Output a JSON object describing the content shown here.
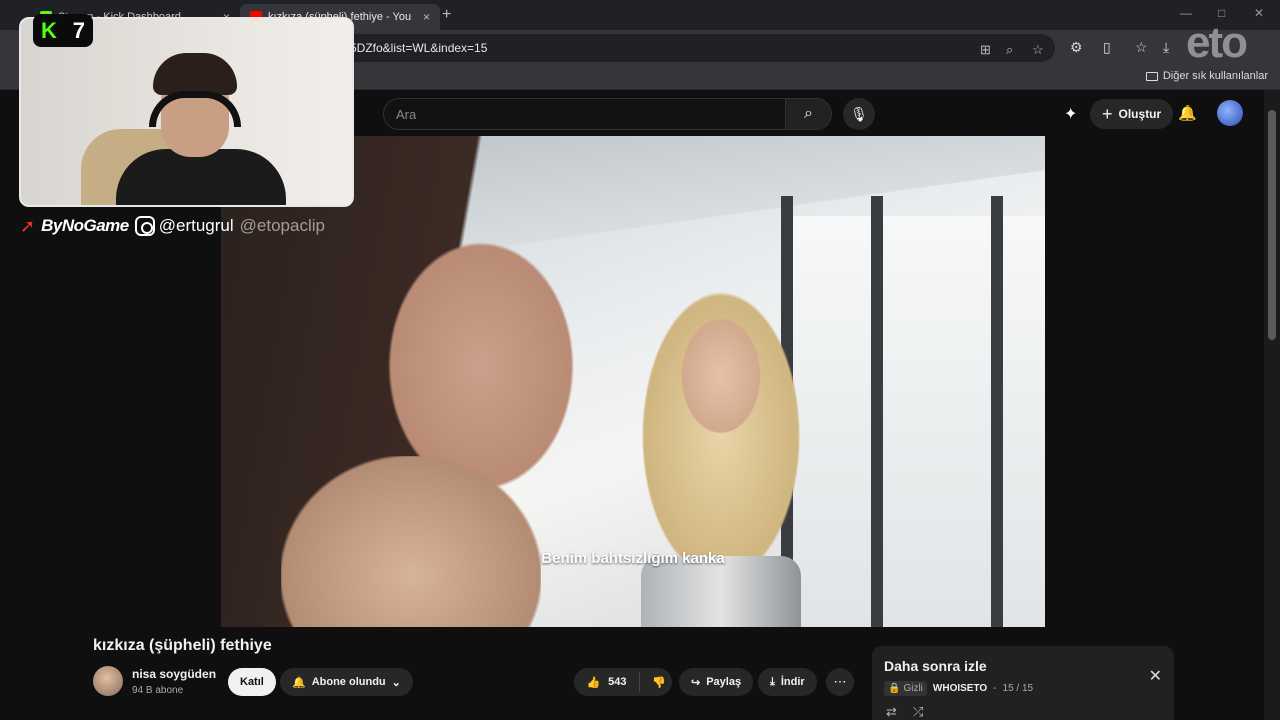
{
  "browser": {
    "tabs": [
      {
        "title": "Stream - Kick Dashboard",
        "favicon_color": "#53fc18"
      },
      {
        "title": "kızkıza (şüpheli) fethiye - You",
        "favicon_color": "#ff0000"
      }
    ],
    "new_tab": "+",
    "url": "5DZfo&list=WL&index=15",
    "bookmarks_folder": "Diğer sık kullanılanlar"
  },
  "youtube": {
    "search_placeholder": "Ara",
    "create_label": "Oluştur",
    "video_subtitle": "Benim bahtsızlığım kanka",
    "video_title": "kızkıza (şüpheli) fethiye",
    "channel": {
      "name": "nisa soygüden",
      "subscribers": "94 B abone"
    },
    "join_label": "Katıl",
    "subscribed_label": "Abone olundu",
    "like_count": "543",
    "share_label": "Paylaş",
    "download_label": "İndir",
    "more_label": "⋯",
    "playlist": {
      "title": "Daha sonra izle",
      "privacy": "Gizli",
      "owner": "WHOISETO",
      "position": "15 / 15"
    }
  },
  "overlay": {
    "kick_badge": {
      "letter": "K",
      "number": "7"
    },
    "brand": "ByNoGame",
    "instagram": "@ertugrul",
    "fade_handle": "@etopaclip",
    "watermark": "eto"
  },
  "colors": {
    "kick_green": "#53fc18",
    "yt_bg": "#0f0f0f"
  }
}
